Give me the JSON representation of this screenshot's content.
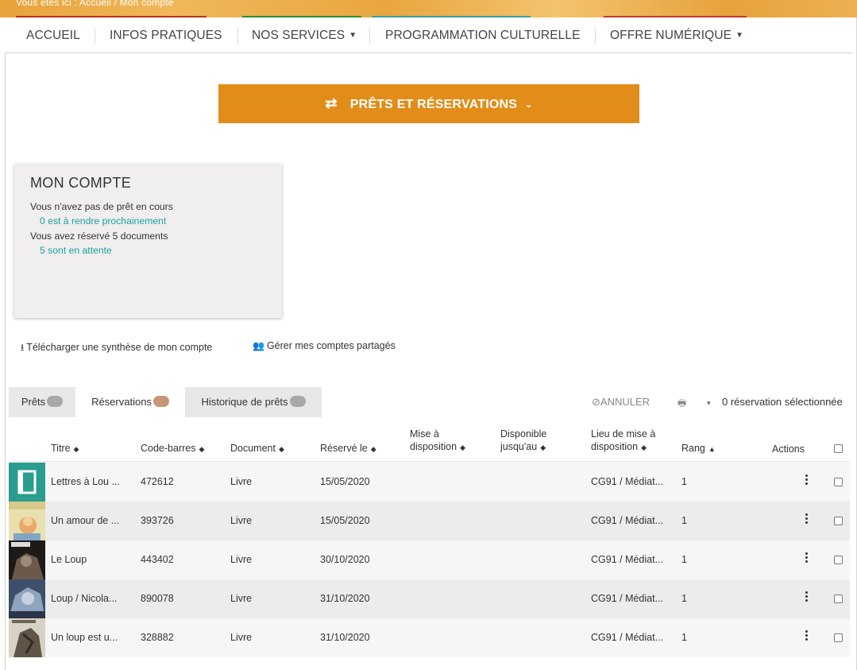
{
  "banner": {
    "text": "Vous êtes ici : Accueil / Mon compte"
  },
  "nav": {
    "items": [
      {
        "label": "ACCUEIL"
      },
      {
        "label": "INFOS PRATIQUES"
      },
      {
        "label": "NOS SERVICES"
      },
      {
        "label": "PROGRAMMATION CULTURELLE"
      },
      {
        "label": "OFFRE NUMÉRIQUE"
      }
    ]
  },
  "main_button": {
    "label": "PRÊTS ET RÉSERVATIONS"
  },
  "account": {
    "title": "MON COMPTE",
    "no_loan": "Vous n'avez pas de prêt en cours",
    "due_soon": "0 est à rendre prochainement",
    "reserved": "Vous avez réservé 5 documents",
    "waiting": "5 sont en attente"
  },
  "links": {
    "download": "Télécharger une synthèse de mon compte",
    "shared": "Gérer mes comptes partagés"
  },
  "tabs": [
    {
      "label": "Prêts"
    },
    {
      "label": "Réservations"
    },
    {
      "label": "Historique de prêts"
    }
  ],
  "toolbar": {
    "cancel": "ANNULER",
    "selection": "0 réservation sélectionnée"
  },
  "table": {
    "headers": {
      "title": "Titre",
      "barcode": "Code-barres",
      "document": "Document",
      "reserved_on": "Réservé le",
      "available_1": "Mise à",
      "available_2": "disposition",
      "until_1": "Disponible",
      "until_2": "jusqu'au",
      "place_1": "Lieu de mise à",
      "place_2": "disposition",
      "rank": "Rang",
      "actions": "Actions"
    },
    "rows": [
      {
        "title": "Lettres à Lou ...",
        "barcode": "472612",
        "document": "Livre",
        "reserved_on": "15/05/2020",
        "place": "CG91 / Médiat...",
        "rank": "1"
      },
      {
        "title": "Un amour de ...",
        "barcode": "393726",
        "document": "Livre",
        "reserved_on": "15/05/2020",
        "place": "CG91 / Médiat...",
        "rank": "1"
      },
      {
        "title": "Le Loup",
        "barcode": "443402",
        "document": "Livre",
        "reserved_on": "30/10/2020",
        "place": "CG91 / Médiat...",
        "rank": "1"
      },
      {
        "title": "Loup / Nicola...",
        "barcode": "890078",
        "document": "Livre",
        "reserved_on": "31/10/2020",
        "place": "CG91 / Médiat...",
        "rank": "1"
      },
      {
        "title": "Un loup est u...",
        "barcode": "328882",
        "document": "Livre",
        "reserved_on": "31/10/2020",
        "place": "CG91 / Médiat...",
        "rank": "1"
      }
    ]
  },
  "colors": {
    "accent": "#e28d19",
    "link": "#1aa3a3",
    "banner": "#e9a640"
  },
  "icons": {
    "main_button": "swap-arrows-icon",
    "download": "download-icon",
    "shared": "users-icon",
    "cancel": "ban-icon",
    "print": "printer-icon",
    "row_actions": "kebab-menu-icon",
    "sort": "sort-icon"
  }
}
